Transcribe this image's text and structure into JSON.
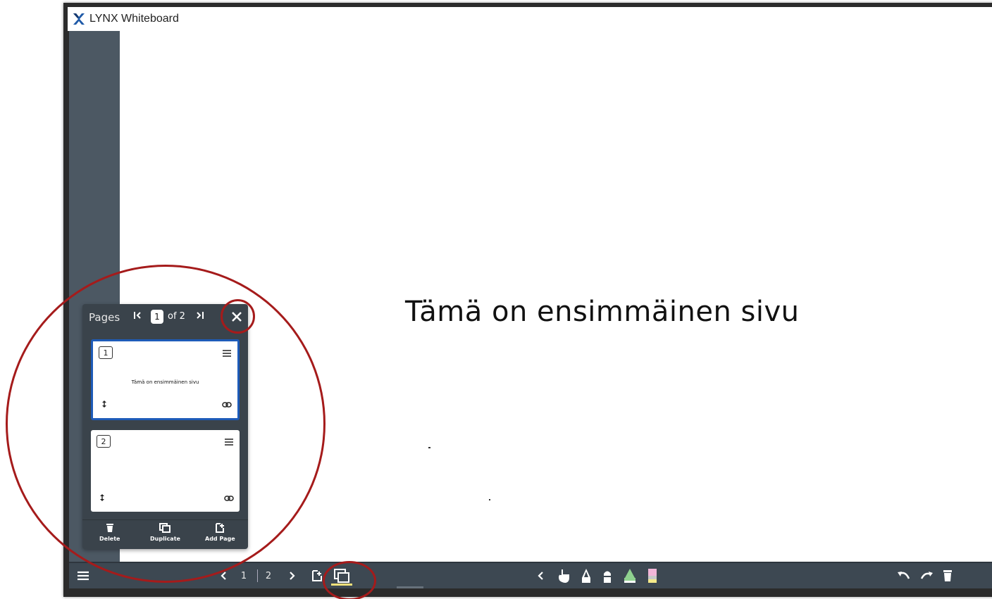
{
  "window": {
    "title": "LYNX Whiteboard"
  },
  "canvas": {
    "text": "Tämä on ensimmäinen sivu"
  },
  "pages_panel": {
    "title": "Pages",
    "current_page": "1",
    "of_label": "of 2",
    "thumbnails": [
      {
        "number": "1",
        "preview_text": "Tämä on ensimmäinen sivu",
        "selected": true
      },
      {
        "number": "2",
        "preview_text": "",
        "selected": false
      }
    ],
    "footer": {
      "delete_label": "Delete",
      "duplicate_label": "Duplicate",
      "add_page_label": "Add Page"
    }
  },
  "toolbar": {
    "current_page": "1",
    "total_pages": "2",
    "icons": [
      "menu-icon",
      "chevron-left-icon",
      "chevron-right-icon",
      "add-page-icon",
      "pages-icon",
      "touch-icon",
      "pen-icon",
      "marker-icon",
      "highlighter-icon",
      "eraser-icon",
      "undo-icon",
      "redo-icon",
      "trash-icon"
    ]
  },
  "colors": {
    "toolbar": "#3d4852",
    "sidebar": "#4c5863",
    "annotation": "#a51b1b",
    "selected_border": "#1e5bb8",
    "active_indicator": "#f0e07a"
  }
}
